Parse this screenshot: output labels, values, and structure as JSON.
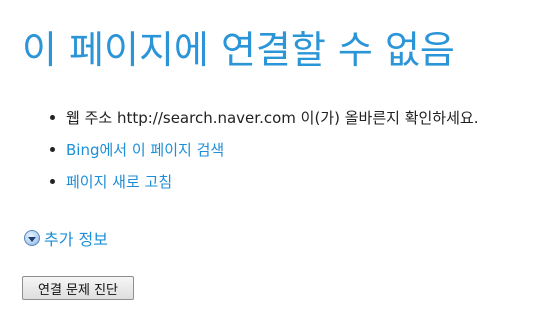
{
  "title": "이 페이지에 연결할 수 없음",
  "bullets": {
    "url_prefix": "웹 주소 ",
    "url": "http://search.naver.com",
    "url_suffix": " 이(가) 올바른지 확인하세요.",
    "search_bing": "Bing에서 이 페이지 검색",
    "refresh": "페이지 새로 고침"
  },
  "more_info": {
    "label": "추가 정보",
    "icon": "expand-arrow-icon"
  },
  "diagnose_button": "연결 문제 진단",
  "colors": {
    "accent": "#2b95d8",
    "link": "#1d8ed8",
    "text": "#222222"
  }
}
